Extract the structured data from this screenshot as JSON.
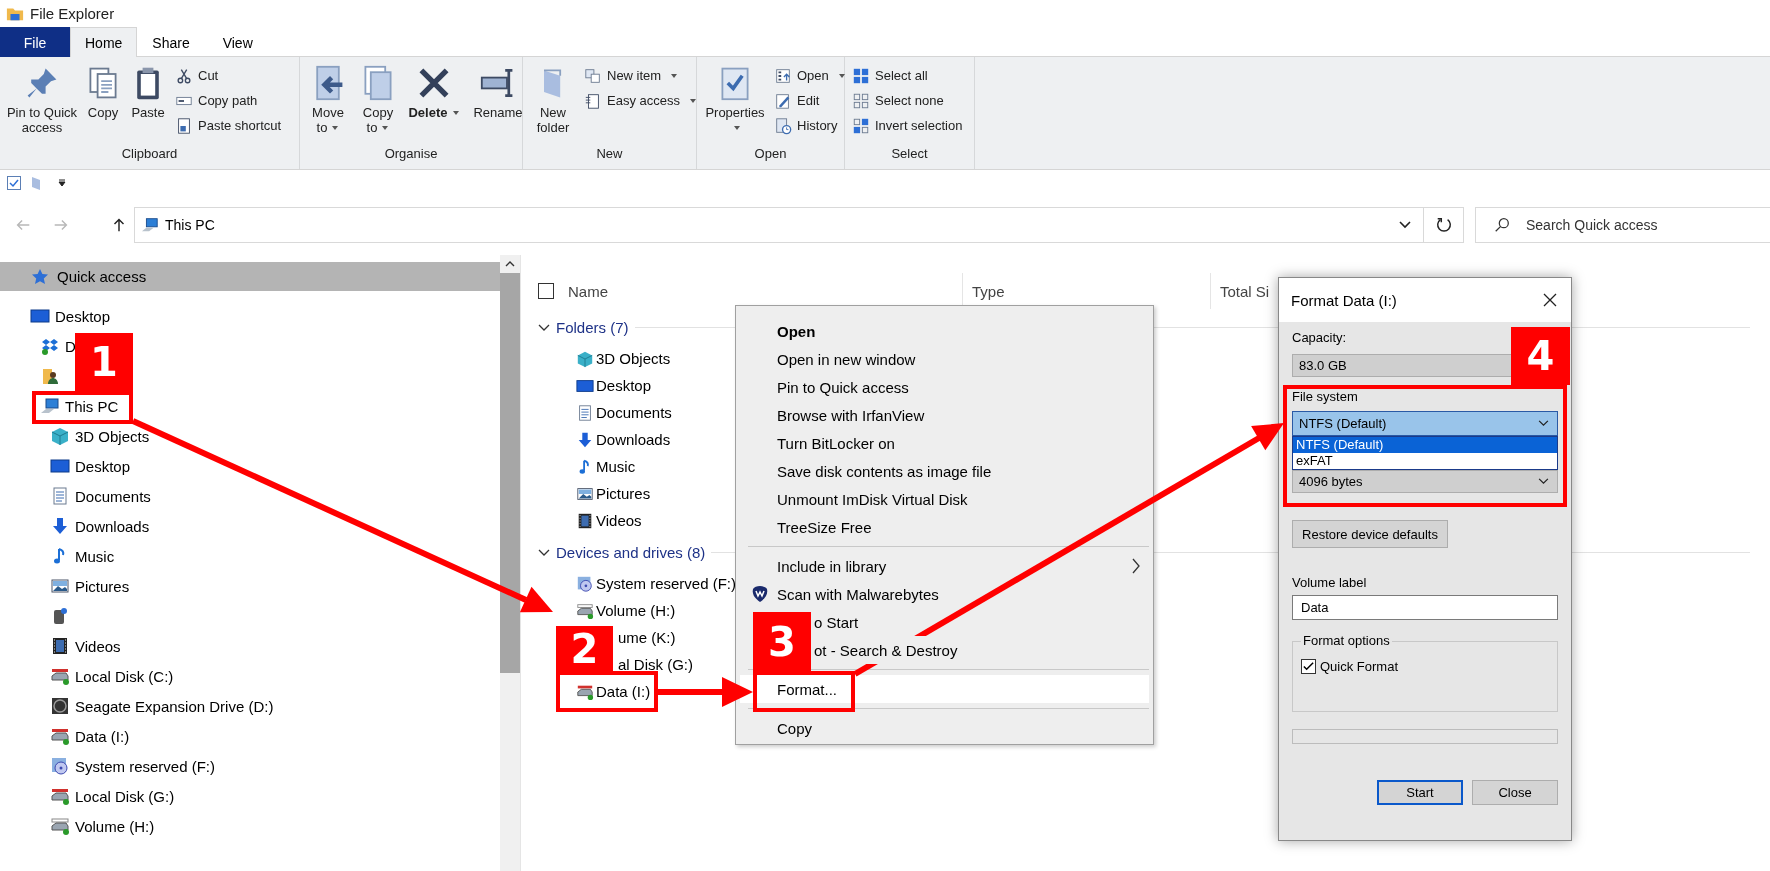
{
  "window": {
    "title": "File Explorer"
  },
  "ribbon_tabs": [
    {
      "label": "File",
      "selected": false,
      "kind": "file"
    },
    {
      "label": "Home",
      "selected": true,
      "kind": "tab"
    },
    {
      "label": "Share",
      "selected": false,
      "kind": "tab"
    },
    {
      "label": "View",
      "selected": false,
      "kind": "tab"
    }
  ],
  "ribbon_groups": [
    {
      "label": "Clipboard",
      "large": [
        {
          "label": "Pin to Quick access"
        },
        {
          "label": "Copy"
        },
        {
          "label": "Paste"
        }
      ],
      "small": [
        {
          "label": "Cut"
        },
        {
          "label": "Copy path"
        },
        {
          "label": "Paste shortcut"
        }
      ]
    },
    {
      "label": "Organise",
      "large": [
        {
          "label": "Move to",
          "dropdown": true
        },
        {
          "label": "Copy to",
          "dropdown": true
        },
        {
          "label": "Delete",
          "dropdown": true,
          "bold": true
        },
        {
          "label": "Rename"
        }
      ]
    },
    {
      "label": "New",
      "large": [
        {
          "label": "New folder"
        }
      ],
      "small": [
        {
          "label": "New item",
          "dropdown": true
        },
        {
          "label": "Easy access",
          "dropdown": true
        }
      ]
    },
    {
      "label": "Open",
      "large": [
        {
          "label": "Properties",
          "dropdown": true
        }
      ],
      "small": [
        {
          "label": "Open",
          "dropdown": true
        },
        {
          "label": "Edit"
        },
        {
          "label": "History"
        }
      ]
    },
    {
      "label": "Select",
      "small": [
        {
          "label": "Select all"
        },
        {
          "label": "Select none"
        },
        {
          "label": "Invert selection"
        }
      ]
    }
  ],
  "address_bar": {
    "nav_buttons": [
      {
        "kind": "back",
        "disabled": true
      },
      {
        "kind": "forward",
        "disabled": true
      },
      {
        "kind": "up",
        "disabled": false
      }
    ],
    "path": "This PC"
  },
  "search": {
    "placeholder": "Search Quick access"
  },
  "nav": {
    "quick_access": {
      "label": "Quick access",
      "selected": true
    },
    "tree": [
      {
        "kind": "labelled",
        "label": "Desktop",
        "children": [
          {
            "kind": "labelled",
            "label": "D"
          },
          {
            "kind": "icon-only"
          },
          {
            "kind": "labelled",
            "label": "This PC",
            "children": [
              {
                "kind": "labelled",
                "label": "3D Objects"
              },
              {
                "kind": "labelled",
                "label": "Desktop"
              },
              {
                "kind": "labelled",
                "label": "Documents"
              },
              {
                "kind": "labelled",
                "label": "Downloads"
              },
              {
                "kind": "labelled",
                "label": "Music"
              },
              {
                "kind": "labelled",
                "label": "Pictures"
              },
              {
                "kind": "icon-only"
              },
              {
                "kind": "labelled",
                "label": "Videos"
              },
              {
                "kind": "labelled",
                "label": "Local Disk (C:)"
              },
              {
                "kind": "labelled",
                "label": "Seagate Expansion Drive (D:)"
              },
              {
                "kind": "labelled",
                "label": "Data (I:)"
              },
              {
                "kind": "labelled",
                "label": "System reserved (F:)"
              },
              {
                "kind": "labelled",
                "label": "Local Disk (G:)"
              },
              {
                "kind": "labelled",
                "label": "Volume (H:)"
              }
            ]
          }
        ]
      }
    ]
  },
  "select_all": {
    "checked": false
  },
  "columns": [
    {
      "label": "Name"
    },
    {
      "label": "Type"
    },
    {
      "label": "Total Si"
    }
  ],
  "groups": [
    {
      "label": "Folders (7)",
      "expanded": true,
      "items": [
        {
          "label": "3D Objects"
        },
        {
          "label": "Desktop"
        },
        {
          "label": "Documents"
        },
        {
          "label": "Downloads"
        },
        {
          "label": "Music"
        },
        {
          "label": "Pictures"
        },
        {
          "label": "Videos"
        }
      ]
    },
    {
      "label": "Devices and drives (8)",
      "expanded": true,
      "items": [
        {
          "label": "System reserved (F:)",
          "clipped": false
        },
        {
          "label": "Volume (H:)",
          "clipped": false
        },
        {
          "label": "ume (K:)",
          "clipped": true
        },
        {
          "label": "al Disk (G:)",
          "clipped": true
        },
        {
          "label": "Data (I:)",
          "clipped": false
        }
      ]
    }
  ],
  "context_menu": {
    "sections": [
      [
        {
          "label": "Open",
          "bold": true,
          "selected": false
        },
        {
          "label": "Open in new window",
          "selected": false
        },
        {
          "label": "Pin to Quick access",
          "selected": false
        },
        {
          "label": "Browse with IrfanView",
          "selected": false
        },
        {
          "label": "Turn BitLocker on",
          "selected": false
        },
        {
          "label": "Save disk contents as image file",
          "selected": false
        },
        {
          "label": "Unmount ImDisk Virtual Disk",
          "selected": false
        },
        {
          "label": "TreeSize Free",
          "selected": false
        }
      ],
      [
        {
          "label": "Include in library",
          "submenu": true,
          "selected": false
        },
        {
          "label": "Scan with Malwarebytes",
          "selected": false
        },
        {
          "label": "o Start",
          "clipped": true,
          "selected": false
        },
        {
          "label": "ot - Search & Destroy",
          "clipped": true,
          "selected": false
        }
      ],
      [
        {
          "label": "Format...",
          "selected": true
        }
      ],
      [
        {
          "label": "Copy",
          "selected": false
        }
      ]
    ]
  },
  "dialog": {
    "title": "Format Data (I:)",
    "capacity": {
      "label": "Capacity:",
      "value": "83.0 GB"
    },
    "file_system": {
      "label": "File system",
      "value": "NTFS (Default)",
      "expanded": true,
      "options": [
        {
          "label": "NTFS (Default)",
          "selected": true
        },
        {
          "label": "exFAT",
          "selected": false
        }
      ]
    },
    "allocation": {
      "value": "4096 bytes"
    },
    "restore_button": "Restore device defaults",
    "volume_label": {
      "label": "Volume label",
      "value": "Data"
    },
    "format_options": {
      "label": "Format options",
      "quick_format": {
        "label": "Quick Format",
        "checked": true
      }
    },
    "progress": {
      "level": 0
    },
    "buttons": [
      {
        "label": "Start",
        "default": true
      },
      {
        "label": "Close",
        "default": false
      }
    ]
  },
  "annotations": {
    "steps": [
      {
        "number": "1"
      },
      {
        "number": "2"
      },
      {
        "number": "3"
      },
      {
        "number": "4"
      }
    ]
  }
}
